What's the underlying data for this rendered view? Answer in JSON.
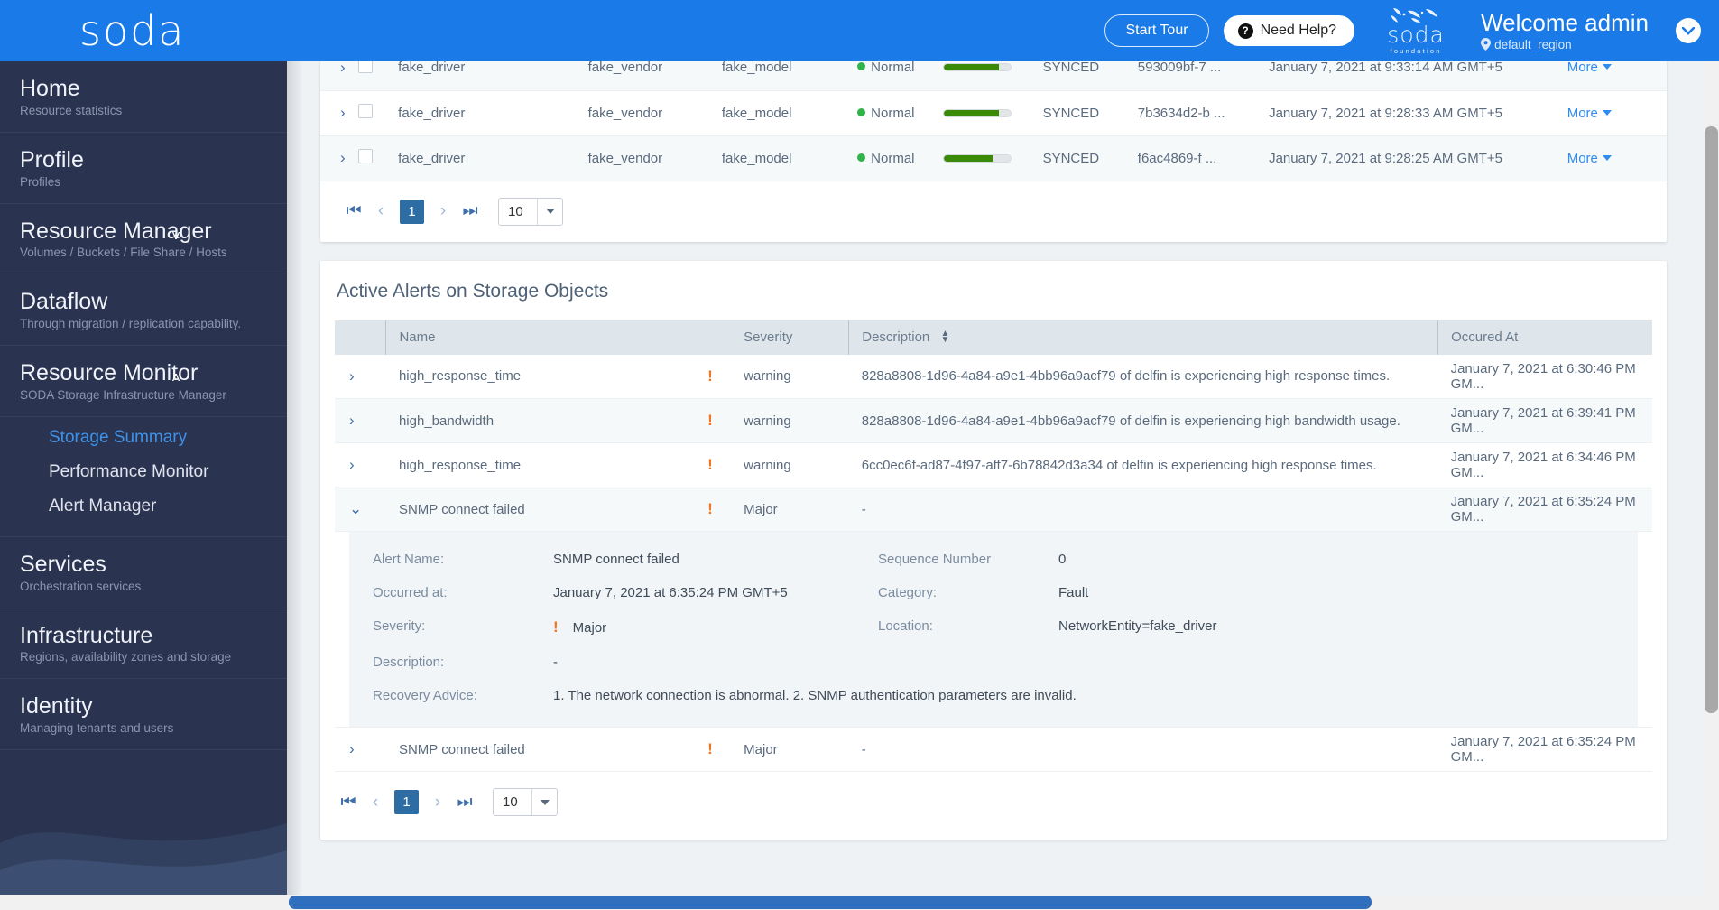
{
  "topbar": {
    "brand": "soda",
    "start_tour": "Start Tour",
    "need_help": "Need Help?",
    "foundation_word": "soda",
    "foundation_sub": "foundation",
    "welcome": "Welcome admin",
    "region": "default_region",
    "accent_color": "#1a7ae8"
  },
  "sidebar": {
    "items": [
      {
        "title": "Home",
        "sub": "Resource statistics",
        "chevron": ""
      },
      {
        "title": "Profile",
        "sub": "Profiles",
        "chevron": ""
      },
      {
        "title": "Resource Manager",
        "sub": "Volumes / Buckets / File Share / Hosts",
        "chevron": "˅"
      },
      {
        "title": "Dataflow",
        "sub": "Through migration / replication capability.",
        "chevron": ""
      },
      {
        "title": "Resource Monitor",
        "sub": "SODA Storage Infrastructure Manager",
        "chevron": "˄"
      },
      {
        "title": "Services",
        "sub": "Orchestration services.",
        "chevron": ""
      },
      {
        "title": "Infrastructure",
        "sub": "Regions, availability zones and storage",
        "chevron": ""
      },
      {
        "title": "Identity",
        "sub": "Managing tenants and users",
        "chevron": ""
      }
    ],
    "monitor_subitems": [
      {
        "label": "Storage Summary",
        "active": true
      },
      {
        "label": "Performance Monitor",
        "active": false
      },
      {
        "label": "Alert Manager",
        "active": false
      }
    ]
  },
  "storage_table": {
    "rows": [
      {
        "driver": "fake_driver",
        "vendor": "fake_vendor",
        "model": "fake_model",
        "status": "Normal",
        "usage_pct": 82,
        "sync": "SYNCED",
        "id": "593009bf-7 ...",
        "time": "January 7, 2021 at 9:33:14 AM GMT+5",
        "more": "More"
      },
      {
        "driver": "fake_driver",
        "vendor": "fake_vendor",
        "model": "fake_model",
        "status": "Normal",
        "usage_pct": 82,
        "sync": "SYNCED",
        "id": "7b3634d2-b ...",
        "time": "January 7, 2021 at 9:28:33 AM GMT+5",
        "more": "More"
      },
      {
        "driver": "fake_driver",
        "vendor": "fake_vendor",
        "model": "fake_model",
        "status": "Normal",
        "usage_pct": 72,
        "sync": "SYNCED",
        "id": "f6ac4869-f ...",
        "time": "January 7, 2021 at 9:28:25 AM GMT+5",
        "more": "More"
      }
    ],
    "pager": {
      "page": "1",
      "page_size": "10"
    }
  },
  "alerts": {
    "title": "Active Alerts on Storage Objects",
    "headers": {
      "name": "Name",
      "severity": "Severity",
      "description": "Description",
      "occured": "Occured At"
    },
    "rows": [
      {
        "name": "high_response_time",
        "severity": "warning",
        "description": "828a8808-1d96-4a84-a9e1-4bb96a9acf79 of delfin is experiencing high response times.",
        "occured": "January 7, 2021 at 6:30:46 PM GM...",
        "expanded": false
      },
      {
        "name": "high_bandwidth",
        "severity": "warning",
        "description": "828a8808-1d96-4a84-a9e1-4bb96a9acf79 of delfin is experiencing high bandwidth usage.",
        "occured": "January 7, 2021 at 6:39:41 PM GM...",
        "expanded": false
      },
      {
        "name": "high_response_time",
        "severity": "warning",
        "description": "6cc0ec6f-ad87-4f97-aff7-6b78842d3a34 of delfin is experiencing high response times.",
        "occured": "January 7, 2021 at 6:34:46 PM GM...",
        "expanded": false
      },
      {
        "name": "SNMP connect failed",
        "severity": "Major",
        "description": "-",
        "occured": "January 7, 2021 at 6:35:24 PM GM...",
        "expanded": true
      },
      {
        "name": "SNMP connect failed",
        "severity": "Major",
        "description": "-",
        "occured": "January 7, 2021 at 6:35:24 PM GM...",
        "expanded": false
      }
    ],
    "detail": {
      "alert_name_label": "Alert Name:",
      "alert_name_value": "SNMP connect failed",
      "sequence_label": "Sequence Number",
      "sequence_value": "0",
      "occurred_label": "Occurred at:",
      "occurred_value": "January 7, 2021 at 6:35:24 PM GMT+5",
      "category_label": "Category:",
      "category_value": "Fault",
      "severity_label": "Severity:",
      "severity_value": "Major",
      "location_label": "Location:",
      "location_value": "NetworkEntity=fake_driver",
      "description_label": "Description:",
      "description_value": "-",
      "recovery_label": "Recovery Advice:",
      "recovery_value": "1. The network connection is abnormal. 2. SNMP authentication parameters are invalid."
    },
    "pager": {
      "page": "1",
      "page_size": "10"
    }
  }
}
